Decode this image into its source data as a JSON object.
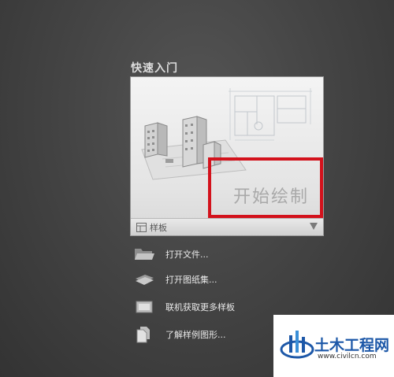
{
  "section": {
    "title": "快速入门"
  },
  "start_card": {
    "label": "开始绘制",
    "template_label": "样板"
  },
  "menu": {
    "items": [
      {
        "label": "打开文件...",
        "icon": "folder-icon"
      },
      {
        "label": "打开图纸集...",
        "icon": "sheet-set-icon"
      },
      {
        "label": "联机获取更多样板",
        "icon": "online-templates-icon"
      },
      {
        "label": "了解样例图形...",
        "icon": "sample-drawings-icon"
      }
    ]
  },
  "watermark": {
    "name": "土木工程网",
    "url": "www.civilcn.com"
  },
  "colors": {
    "highlight": "#d3121c",
    "logo_blue": "#1d58a8"
  }
}
